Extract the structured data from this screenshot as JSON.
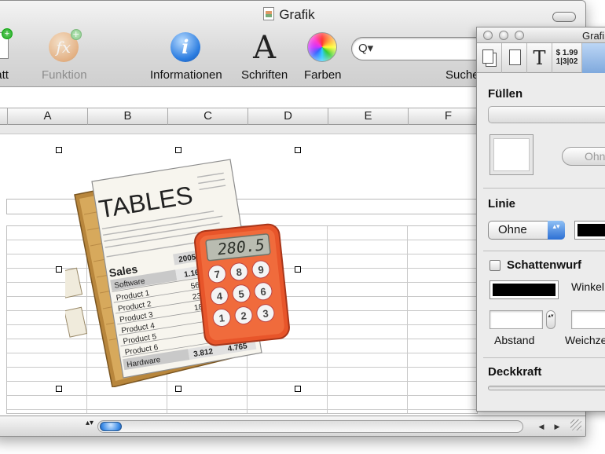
{
  "window": {
    "title": "Grafik"
  },
  "toolbar": {
    "items": [
      {
        "label": "sblatt",
        "icon": "add-sheet-icon",
        "enabled": true
      },
      {
        "label": "Funktion",
        "icon": "function-fx-icon",
        "enabled": false
      },
      {
        "label": "Informationen",
        "icon": "info-icon",
        "enabled": true
      },
      {
        "label": "Schriften",
        "icon": "fonts-icon",
        "enabled": true
      },
      {
        "label": "Farben",
        "icon": "colors-icon",
        "enabled": true
      }
    ],
    "search_label": "Suche",
    "search_value": "",
    "search_glyph": "Q▾",
    "fx_glyph": "fx",
    "info_glyph": "i",
    "fonts_glyph": "A",
    "plus_glyph": "+"
  },
  "columns": [
    "A",
    "B",
    "C",
    "D",
    "E",
    "F"
  ],
  "image": {
    "name": "tables-calculator-graphic",
    "heading": "TABLES",
    "calculator_display": "280.5",
    "sales_label": "Sales",
    "year_label": "2005",
    "rows": [
      {
        "name": "Software",
        "value": "1.168"
      },
      {
        "name": "Product 1",
        "value": "560"
      },
      {
        "name": "Product 2",
        "value": "230"
      },
      {
        "name": "Product 3",
        "value": "18"
      },
      {
        "name": "Product 4",
        "value": ""
      },
      {
        "name": "Product 5",
        "value": ""
      },
      {
        "name": "Product 6",
        "value": ""
      },
      {
        "name": "Hardware",
        "value": "3.812"
      }
    ],
    "total_value": "4.765",
    "keys": [
      "7",
      "8",
      "9",
      "4",
      "5",
      "6",
      "1",
      "2",
      "3"
    ]
  },
  "scrollbar": {
    "stepper": "▴▾",
    "left_arrow": "◀",
    "right_arrow": "▶"
  },
  "inspector": {
    "title": "Grafik",
    "tabs": [
      {
        "icon": "documents-icon"
      },
      {
        "icon": "page-icon"
      },
      {
        "icon": "text-icon",
        "glyph": "T"
      },
      {
        "icon": "number-format-icon",
        "line1": "$ 1.99",
        "line2": "1|3|02"
      },
      {
        "icon": "graphic-icon"
      }
    ],
    "fill_label": "Füllen",
    "fill_button": "Ohne",
    "line_label": "Linie",
    "line_style": "Ohne",
    "line_stepper": "▴▾",
    "line_color": "#000000",
    "shadow_label": "Schattenwurf",
    "shadow_checked": false,
    "angle_label": "Winkel",
    "distance_label": "Abstand",
    "blur_label": "Weichze",
    "mini_stepper": "▴▾",
    "opacity_label": "Deckkraft"
  },
  "colors": {
    "accent_blue": "#2c6fd4",
    "calculator_orange": "#e8552a",
    "paper": "#f7f5ee"
  }
}
